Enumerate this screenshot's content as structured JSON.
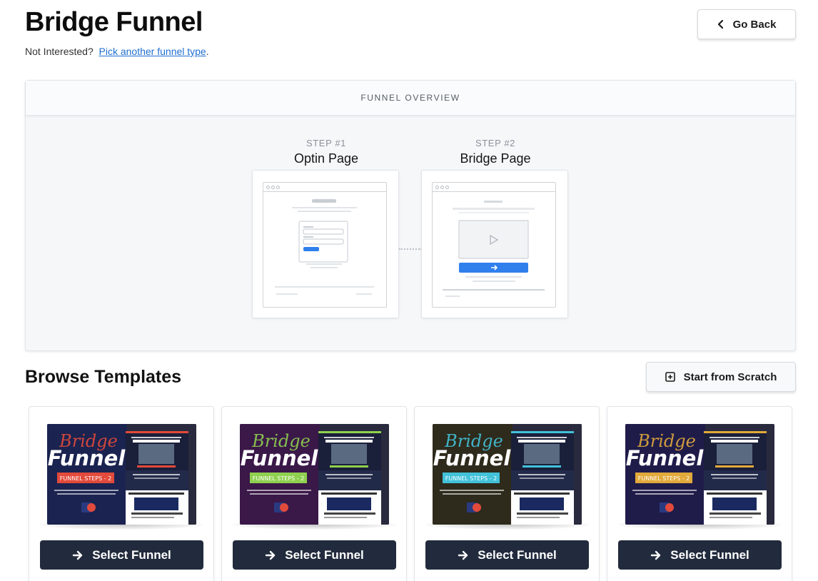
{
  "header": {
    "title": "Bridge Funnel",
    "not_interested": "Not Interested?",
    "pick_link": "Pick another funnel type",
    "pick_suffix": ".",
    "go_back": "Go Back"
  },
  "overview": {
    "heading": "FUNNEL OVERVIEW",
    "steps": [
      {
        "number": "STEP #1",
        "name": "Optin Page"
      },
      {
        "number": "STEP #2",
        "name": "Bridge Page"
      }
    ]
  },
  "browse": {
    "title": "Browse Templates",
    "start_scratch": "Start from Scratch"
  },
  "templates": [
    {
      "headline_script": "Bridge",
      "headline": "Funnel",
      "badge": "FUNNEL STEPS - 2",
      "button": "Select Funnel",
      "accent": "#e24a3b",
      "bg": "#1b2350"
    },
    {
      "headline_script": "Bridge",
      "headline": "Funnel",
      "badge": "FUNNEL STEPS - 2",
      "button": "Select Funnel",
      "accent": "#8fd14f",
      "bg": "#3a1848"
    },
    {
      "headline_script": "Bridge",
      "headline": "Funnel",
      "badge": "FUNNEL STEPS - 2",
      "button": "Select Funnel",
      "accent": "#42c2d9",
      "bg": "#2e2a1c"
    },
    {
      "headline_script": "Bridge",
      "headline": "Funnel",
      "badge": "FUNNEL STEPS - 2",
      "button": "Select Funnel",
      "accent": "#e2a93b",
      "bg": "#1f1c4a"
    }
  ]
}
